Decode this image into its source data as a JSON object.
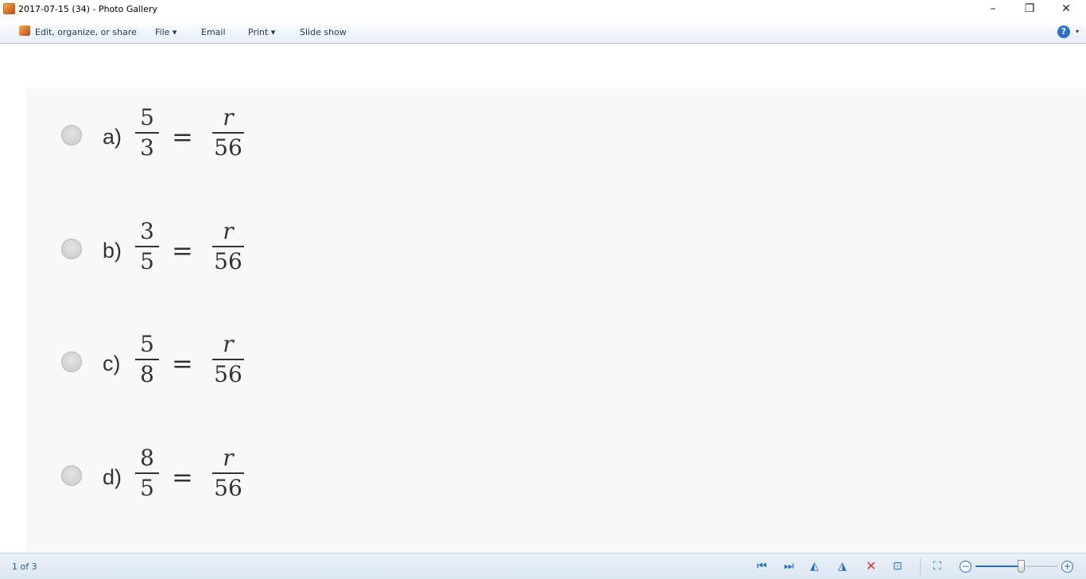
{
  "window": {
    "title": "2017-07-15 (34) - Photo Gallery",
    "minimize": "–",
    "restore": "❐",
    "close": "✕"
  },
  "toolbar": {
    "edit": "Edit, organize, or share",
    "file": "File ▾",
    "email": "Email",
    "print": "Print ▾",
    "slideshow": "Slide show",
    "help": "?",
    "help_caret": "▾"
  },
  "options": [
    {
      "label": "a)",
      "num": "5",
      "den": "3",
      "eq": "=",
      "rnum": "r",
      "rden": "56"
    },
    {
      "label": "b)",
      "num": "3",
      "den": "5",
      "eq": "=",
      "rnum": "r",
      "rden": "56"
    },
    {
      "label": "c)",
      "num": "5",
      "den": "8",
      "eq": "=",
      "rnum": "r",
      "rden": "56"
    },
    {
      "label": "d)",
      "num": "8",
      "den": "5",
      "eq": "=",
      "rnum": "r",
      "rden": "56"
    }
  ],
  "status": {
    "count": "1 of 3",
    "zoom_level": 0.55,
    "icons": {
      "prev": "⏮",
      "next": "⏭",
      "rotl": "◭",
      "rotr": "◮",
      "del": "✕",
      "slide": "⊡",
      "fit": "⛶",
      "minus": "−",
      "plus": "+"
    }
  }
}
